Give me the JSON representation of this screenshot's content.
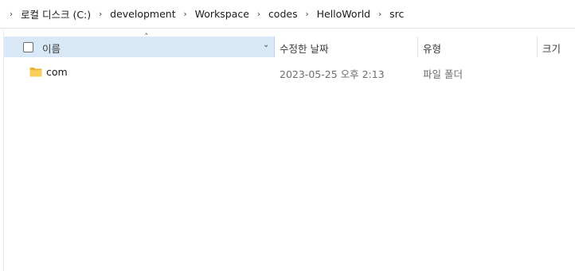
{
  "breadcrumb": {
    "items": [
      "로컬 디스크 (C:)",
      "development",
      "Workspace",
      "codes",
      "HelloWorld",
      "src"
    ],
    "separator": "›"
  },
  "columns": {
    "name": "이름",
    "date_modified": "수정한 날짜",
    "type": "유형",
    "size": "크기"
  },
  "icons": {
    "sort": "chevron-up",
    "column_dropdown": "chevron-down",
    "folder": "folder-icon"
  },
  "files": [
    {
      "name": "com",
      "date_modified": "2023-05-25 오후 2:13",
      "type": "파일 폴더",
      "size": ""
    }
  ],
  "colors": {
    "header_selected": "#d9e8f7",
    "folder": "#f4c542"
  }
}
